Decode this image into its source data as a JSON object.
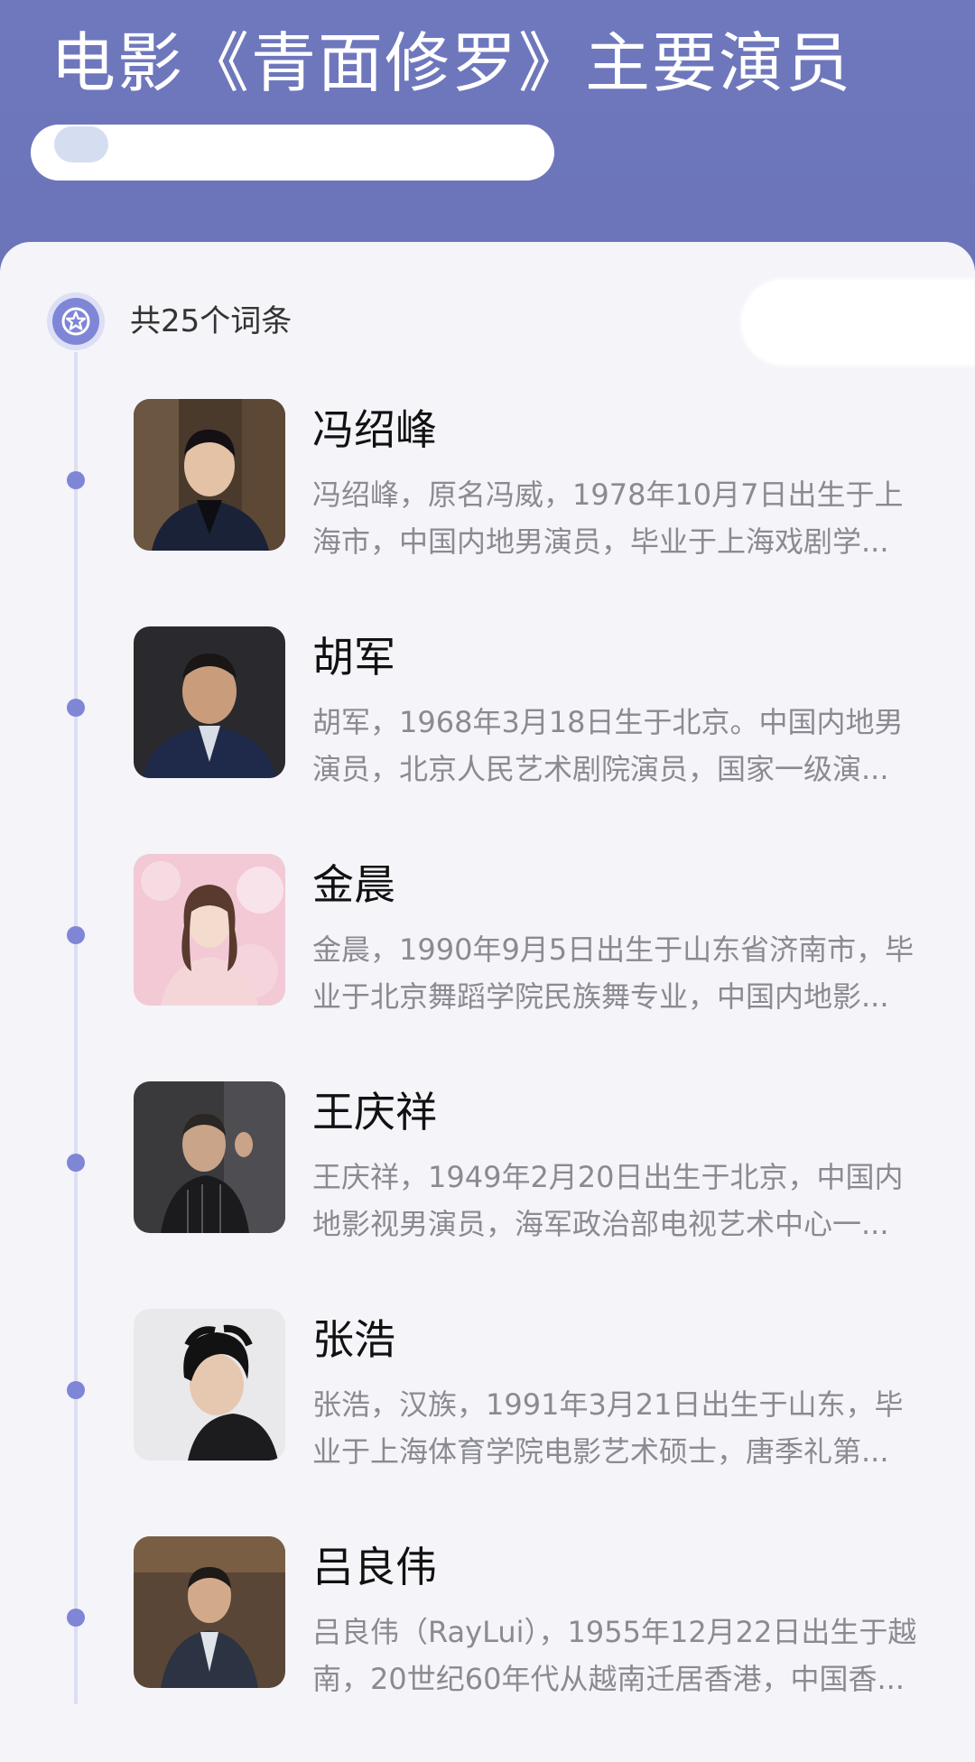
{
  "header": {
    "title": "电影《青面修罗》主要演员"
  },
  "summary": {
    "count_label": "共25个词条"
  },
  "actors": [
    {
      "name": "冯绍峰",
      "desc_line1": "冯绍峰，原名冯威，1978年10月7日出生于上",
      "desc_line2": "海市，中国内地男演员，毕业于上海戏剧学..."
    },
    {
      "name": "胡军",
      "desc_line1": "胡军，1968年3月18日生于北京。中国内地男",
      "desc_line2": "演员，北京人民艺术剧院演员，国家一级演..."
    },
    {
      "name": "金晨",
      "desc_line1": "金晨，1990年9月5日出生于山东省济南市，毕",
      "desc_line2": "业于北京舞蹈学院民族舞专业，中国内地影..."
    },
    {
      "name": "王庆祥",
      "desc_line1": "王庆祥，1949年2月20日出生于北京，中国内",
      "desc_line2": "地影视男演员，海军政治部电视艺术中心一..."
    },
    {
      "name": "张浩",
      "desc_line1": "张浩，汉族，1991年3月21日出生于山东，毕",
      "desc_line2": "业于上海体育学院电影艺术硕士，唐季礼第..."
    },
    {
      "name": "吕良伟",
      "desc_line1": "吕良伟（RayLui），1955年12月22日出生于越",
      "desc_line2": "南，20世纪60年代从越南迁居香港，中国香..."
    }
  ],
  "colors": {
    "header_bg": "#6f78bd",
    "accent": "#7f86d6",
    "timeline": "#dcdff2",
    "desc_text": "#8a8a92"
  },
  "icons": {
    "badge": "star-icon"
  }
}
